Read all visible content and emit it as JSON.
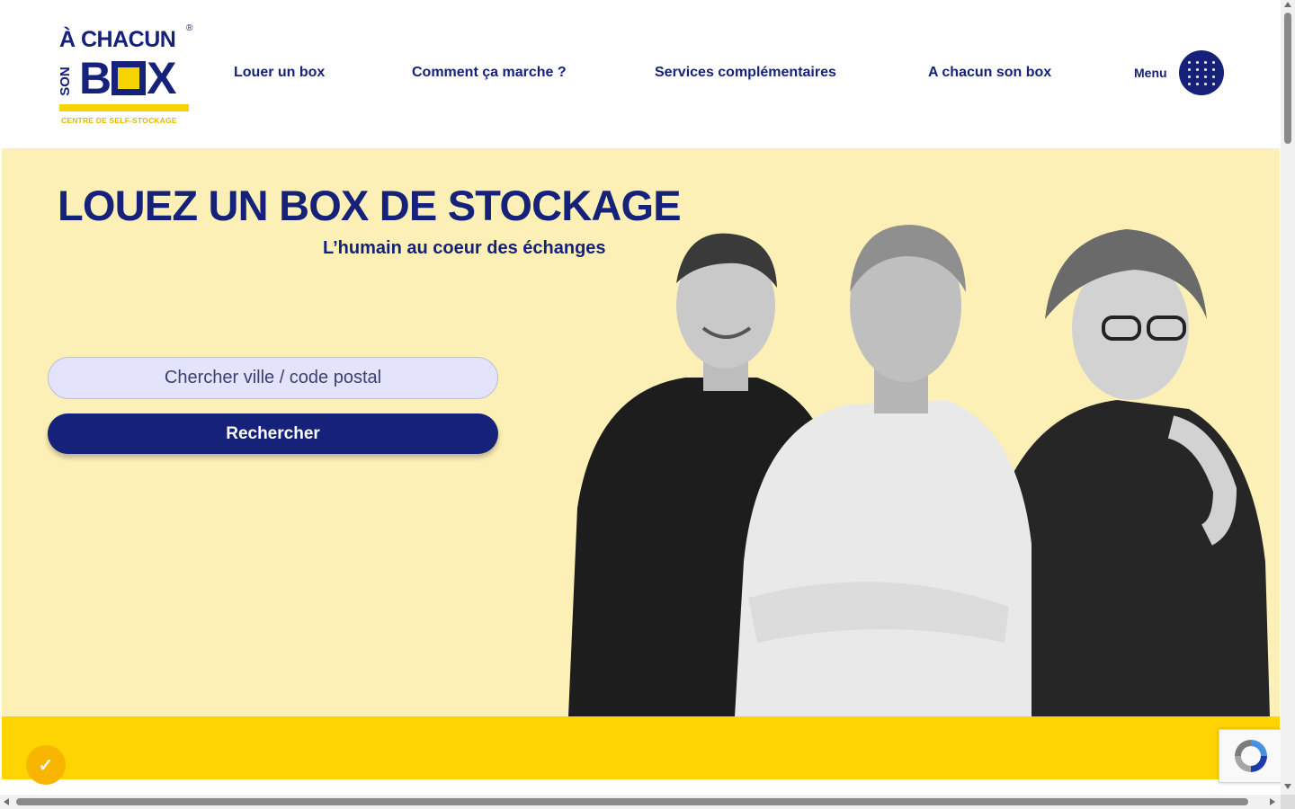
{
  "logo": {
    "line1": "À CHACUN",
    "son": "SON",
    "box_b": "B",
    "box_x": "X",
    "registered": "®",
    "tagline": "CENTRE DE SELF-STOCKAGE"
  },
  "nav": {
    "items": [
      {
        "label": "Louer un box"
      },
      {
        "label": "Comment ça marche ?"
      },
      {
        "label": "Services complémentaires"
      },
      {
        "label": "A chacun son box"
      }
    ],
    "menu_label": "Menu"
  },
  "hero": {
    "title": "LOUEZ UN BOX DE STOCKAGE",
    "subtitle": "L’humain au coeur des échanges",
    "search_placeholder": "Chercher ville / code postal",
    "search_button": "Recherche r"
  },
  "colors": {
    "brand_navy": "#16217a",
    "brand_yellow": "#ffd400",
    "hero_bg": "#fdf0b6"
  },
  "icons": {
    "menu": "grid-dots-icon",
    "consent": "check-icon",
    "recaptcha": "recaptcha-icon"
  }
}
